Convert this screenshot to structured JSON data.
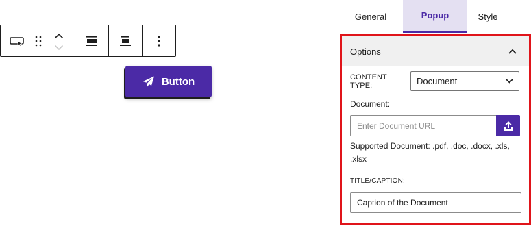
{
  "toolbar": {
    "icons": [
      "button-block-icon",
      "drag-handle-icon",
      "move-up-icon",
      "move-down-icon",
      "justify-space-icon",
      "align-center-icon",
      "more-options-icon"
    ]
  },
  "button_block": {
    "label": "Button",
    "icon": "paper-plane-icon",
    "color": "#4b2aa6"
  },
  "panel": {
    "tabs": [
      {
        "label": "General"
      },
      {
        "label": "Popup",
        "active": true
      },
      {
        "label": "Style"
      }
    ],
    "options": {
      "title": "Options",
      "content_type_label": "CONTENT TYPE:",
      "content_type_value": "Document",
      "document_label": "Document:",
      "document_url_placeholder": "Enter Document URL",
      "supported_text": "Supported Document: .pdf, .doc, .docx, .xls, .xlsx",
      "caption_label": "TITLE/CAPTION:",
      "caption_value": "Caption of the Document"
    },
    "accent_color": "#4b2aa6",
    "highlight_color": "#e0141a"
  }
}
